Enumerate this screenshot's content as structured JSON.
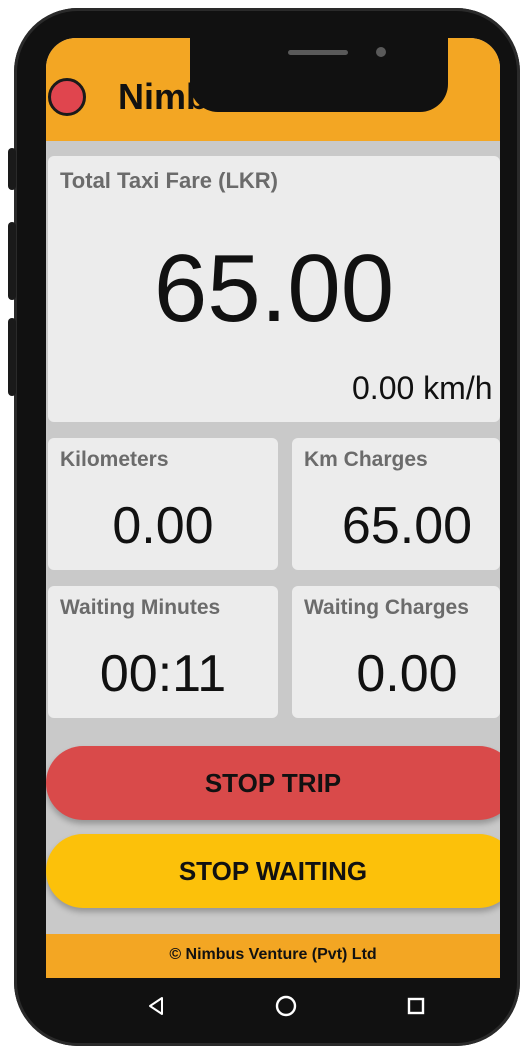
{
  "header": {
    "title": "Nimbus Taxi Meter",
    "status_color": "#e0454e",
    "bar_color": "#f3a623"
  },
  "fare": {
    "label": "Total Taxi Fare (LKR)",
    "value": "65.00",
    "speed": "0.00 km/h"
  },
  "stats": [
    {
      "label": "Kilometers",
      "value": "0.00"
    },
    {
      "label": "Km Charges",
      "value": "65.00"
    },
    {
      "label": "Waiting Minutes",
      "value": "00:11"
    },
    {
      "label": "Waiting Charges",
      "value": "0.00"
    }
  ],
  "buttons": {
    "stop_trip": "STOP TRIP",
    "stop_waiting": "STOP WAITING",
    "stop_trip_color": "#d94a4a",
    "stop_waiting_color": "#fcc10a"
  },
  "footer": {
    "text": "© Nimbus Venture (Pvt) Ltd"
  },
  "navbar": {
    "icons": [
      "back-icon",
      "home-icon",
      "recents-icon"
    ]
  }
}
